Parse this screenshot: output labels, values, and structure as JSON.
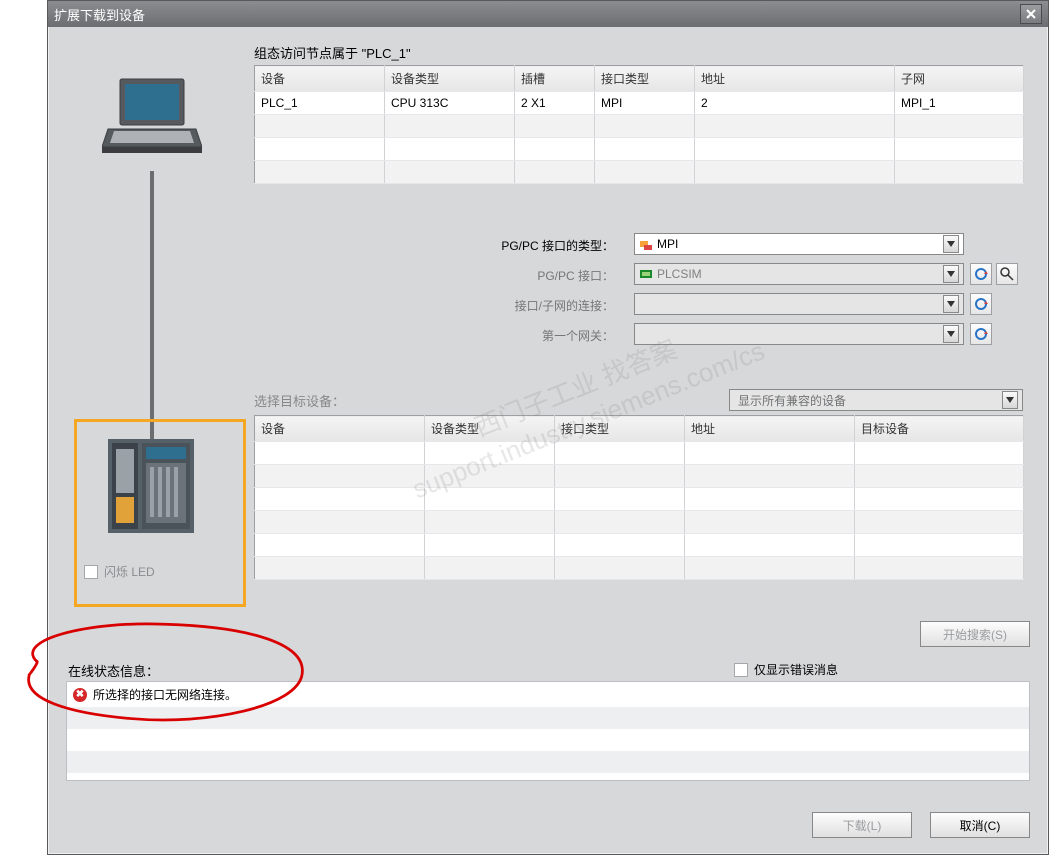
{
  "title": "扩展下载到设备",
  "heading": "组态访问节点属于 \"PLC_1\"",
  "table1": {
    "headers": [
      "设备",
      "设备类型",
      "插槽",
      "接口类型",
      "地址",
      "子网"
    ],
    "row": {
      "c0": "PLC_1",
      "c1": "CPU 313C",
      "c2": "2 X1",
      "c3": "MPI",
      "c4": "2",
      "c5": "MPI_1"
    }
  },
  "form": {
    "pgpc_type_label": "PG/PC 接口的类型：",
    "pgpc_type_value": "MPI",
    "pgpc_if_label": "PG/PC 接口：",
    "pgpc_if_value": "PLCSIM",
    "conn_label": "接口/子网的连接：",
    "gateway_label": "第一个网关："
  },
  "select_target_label": "选择目标设备：",
  "compat_dd": "显示所有兼容的设备",
  "table2": {
    "headers": [
      "设备",
      "设备类型",
      "接口类型",
      "地址",
      "目标设备"
    ]
  },
  "flash_led": "闪烁 LED",
  "start_search": "开始搜索(S)",
  "status_label": "在线状态信息：",
  "only_errors": "仅显示错误消息",
  "error_msg": "所选择的接口无网络连接。",
  "download_btn": "下载(L)",
  "cancel_btn": "取消(C)",
  "watermark_line1": "西门子工业   找答案",
  "watermark_line2": "support.industry.siemens.com/cs"
}
